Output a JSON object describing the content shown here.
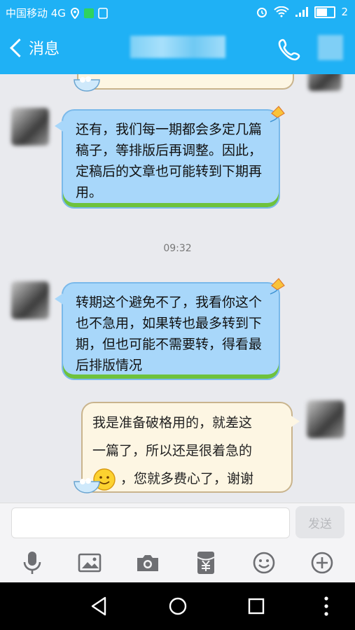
{
  "status_bar": {
    "carrier": "中国移动 4G",
    "battery_text": "2",
    "battery_level": 0.65
  },
  "navbar": {
    "back_label": "消息"
  },
  "messages": [
    {
      "id": "m1",
      "side": "left",
      "text": "还有，我们每一期都会多定几篇稿子，等排版后再调整。因此，定稿后的文章也可能转到下期再用。"
    },
    {
      "id": "m2",
      "side": "left",
      "text": "转期这个避免不了，我看你这个也不急用，如果转也最多转到下期，但也可能不需要转，得看最后排版情况"
    },
    {
      "id": "m3",
      "side": "right",
      "line1": "我是准备破格用的，就差这",
      "line2": "一篇了，所以还是很着急的",
      "line3": "，您就多费心了，谢谢"
    }
  ],
  "timestamp": "09:32",
  "input": {
    "placeholder": "",
    "send_label": "发送"
  },
  "toolbar_icons": [
    "microphone-icon",
    "image-icon",
    "camera-icon",
    "red-packet-icon",
    "emoji-icon",
    "plus-icon"
  ],
  "colors": {
    "accent": "#1fb1f5",
    "bubble_blue": "#a8d7fa",
    "bubble_cream": "#fdf6e3",
    "grass": "#6ec23c"
  }
}
